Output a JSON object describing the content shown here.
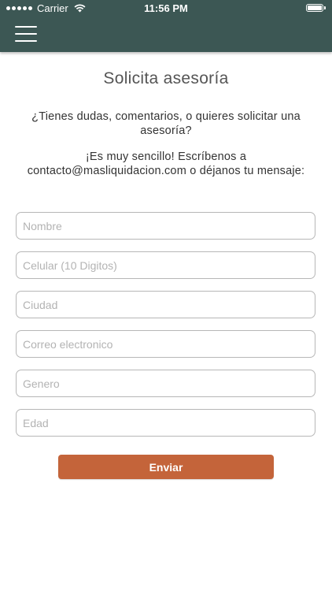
{
  "status_bar": {
    "carrier": "Carrier",
    "time": "11:56 PM"
  },
  "header": {
    "menu_icon": "hamburger-menu-icon",
    "background_color": "#3c5754"
  },
  "content": {
    "title": "Solicita asesoría",
    "description_1": "¿Tienes dudas, comentarios, o quieres solicitar una asesoría?",
    "description_2": "¡Es muy sencillo! Escríbenos a contacto@masliquidacion.com o déjanos tu mensaje:"
  },
  "form": {
    "fields": [
      {
        "placeholder": "Nombre",
        "value": ""
      },
      {
        "placeholder": "Celular (10 Digitos)",
        "value": ""
      },
      {
        "placeholder": "Ciudad",
        "value": ""
      },
      {
        "placeholder": "Correo electronico",
        "value": ""
      },
      {
        "placeholder": "Genero",
        "value": ""
      },
      {
        "placeholder": "Edad",
        "value": ""
      }
    ],
    "submit_label": "Enviar",
    "submit_color": "#c4643a"
  }
}
